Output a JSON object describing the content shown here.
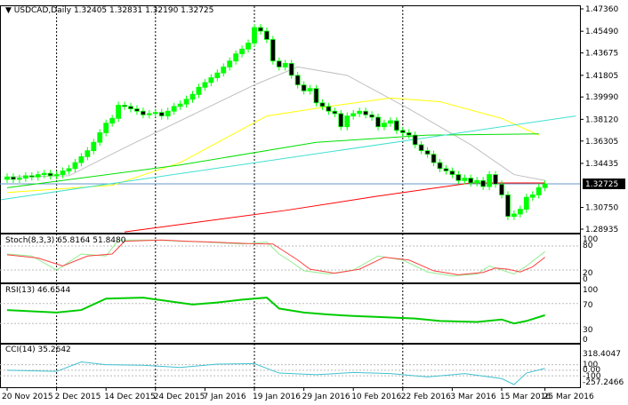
{
  "header": {
    "symbol": "USDCAD",
    "timeframe": "Daily",
    "ohlc": "1.32405 1.32831 1.32190 1.32725"
  },
  "indicators": {
    "stoch": {
      "label": "Stoch(8,3,3) 65.8164 51.8480",
      "levels": [
        "100",
        "80",
        "20",
        "0"
      ]
    },
    "rsi": {
      "label": "RSI(13) 46.6544",
      "levels": [
        "100",
        "70",
        "30",
        "0"
      ]
    },
    "cci": {
      "label": "CCI(14) 35.2642",
      "levels": [
        "318.4047",
        "100",
        "0.00",
        "-100",
        "-257.2466"
      ]
    }
  },
  "colors": {
    "bull": "#00ff00",
    "bear": "#000000",
    "ma_red": "#ff0000",
    "ma_yellow": "#ffff00",
    "ma_green": "#00e000",
    "ma_grey": "#c0c0c0",
    "trend": "#40e0d0",
    "price_line": "#6699cc",
    "stoch_k": "#90ee90",
    "stoch_d": "#ff4040",
    "rsi": "#00cc00",
    "cci": "#40c0d0"
  },
  "chart_data": {
    "type": "candlestick",
    "title": "USDCAD Daily",
    "ylim": [
      1.28935,
      1.4736
    ],
    "y_ticks": [
      "1.47360",
      "1.45490",
      "1.43675",
      "1.41805",
      "1.39990",
      "1.38120",
      "1.36305",
      "1.34435",
      "1.30750",
      "1.28935"
    ],
    "current_price": "1.32725",
    "x_labels": [
      "20 Nov 2015",
      "2 Dec 2015",
      "14 Dec 2015",
      "24 Dec 2015",
      "7 Jan 2016",
      "19 Jan 2016",
      "29 Jan 2016",
      "10 Feb 2016",
      "22 Feb 2016",
      "3 Mar 2016",
      "15 Mar 2016",
      "25 Mar 2016"
    ],
    "x_label_bars": [
      0,
      8,
      16,
      24,
      32,
      40,
      48,
      56,
      64,
      72,
      80,
      87
    ],
    "closes": [
      1.333,
      1.331,
      1.332,
      1.334,
      1.333,
      1.335,
      1.336,
      1.334,
      1.335,
      1.338,
      1.34,
      1.345,
      1.35,
      1.355,
      1.362,
      1.37,
      1.378,
      1.382,
      1.393,
      1.392,
      1.39,
      1.388,
      1.385,
      1.386,
      1.387,
      1.384,
      1.388,
      1.392,
      1.394,
      1.398,
      1.402,
      1.408,
      1.412,
      1.416,
      1.42,
      1.425,
      1.43,
      1.436,
      1.44,
      1.445,
      1.458,
      1.455,
      1.448,
      1.43,
      1.425,
      1.428,
      1.418,
      1.41,
      1.405,
      1.407,
      1.395,
      1.392,
      1.388,
      1.386,
      1.375,
      1.384,
      1.386,
      1.388,
      1.385,
      1.383,
      1.375,
      1.378,
      1.38,
      1.372,
      1.37,
      1.368,
      1.36,
      1.355,
      1.352,
      1.345,
      1.34,
      1.338,
      1.335,
      1.33,
      1.332,
      1.328,
      1.33,
      1.325,
      1.335,
      1.327,
      1.318,
      1.3,
      1.302,
      1.306,
      1.316,
      1.318,
      1.3241,
      1.32725
    ],
    "ma_lines": [
      {
        "name": "ma_grey",
        "points": [
          [
            0,
            1.333
          ],
          [
            10,
            1.334
          ],
          [
            20,
            1.36
          ],
          [
            30,
            1.385
          ],
          [
            40,
            1.41
          ],
          [
            47,
            1.425
          ],
          [
            55,
            1.418
          ],
          [
            65,
            1.39
          ],
          [
            75,
            1.36
          ],
          [
            82,
            1.335
          ],
          [
            87,
            1.33
          ]
        ]
      },
      {
        "name": "ma_yellow",
        "points": [
          [
            0,
            1.32
          ],
          [
            17,
            1.326
          ],
          [
            28,
            1.345
          ],
          [
            42,
            1.384
          ],
          [
            52,
            1.392
          ],
          [
            62,
            1.399
          ],
          [
            70,
            1.396
          ],
          [
            80,
            1.382
          ],
          [
            86,
            1.368
          ]
        ]
      },
      {
        "name": "ma_green",
        "points": [
          [
            0,
            1.324
          ],
          [
            28,
            1.343
          ],
          [
            50,
            1.362
          ],
          [
            68,
            1.368
          ],
          [
            86,
            1.369
          ]
        ]
      },
      {
        "name": "ma_red",
        "points": [
          [
            19,
            1.287
          ],
          [
            45,
            1.305
          ],
          [
            60,
            1.317
          ],
          [
            75,
            1.328
          ],
          [
            87,
            1.328
          ]
        ]
      },
      {
        "name": "trend",
        "points": [
          [
            -1,
            1.314
          ],
          [
            92,
            1.384
          ]
        ]
      }
    ],
    "stoch_k": [
      [
        0,
        60
      ],
      [
        4,
        55
      ],
      [
        8,
        20
      ],
      [
        12,
        60
      ],
      [
        16,
        55
      ],
      [
        18,
        95
      ],
      [
        24,
        95
      ],
      [
        28,
        92
      ],
      [
        32,
        90
      ],
      [
        38,
        85
      ],
      [
        42,
        90
      ],
      [
        44,
        60
      ],
      [
        46,
        40
      ],
      [
        48,
        18
      ],
      [
        52,
        10
      ],
      [
        56,
        20
      ],
      [
        60,
        55
      ],
      [
        64,
        45
      ],
      [
        68,
        15
      ],
      [
        72,
        5
      ],
      [
        76,
        10
      ],
      [
        78,
        30
      ],
      [
        80,
        20
      ],
      [
        82,
        10
      ],
      [
        84,
        30
      ],
      [
        87,
        66
      ]
    ],
    "stoch_d": [
      [
        0,
        58
      ],
      [
        5,
        50
      ],
      [
        9,
        30
      ],
      [
        13,
        55
      ],
      [
        17,
        60
      ],
      [
        19,
        92
      ],
      [
        25,
        95
      ],
      [
        29,
        92
      ],
      [
        33,
        90
      ],
      [
        39,
        86
      ],
      [
        43,
        85
      ],
      [
        45,
        65
      ],
      [
        47,
        45
      ],
      [
        49,
        22
      ],
      [
        53,
        12
      ],
      [
        57,
        22
      ],
      [
        61,
        52
      ],
      [
        65,
        45
      ],
      [
        69,
        18
      ],
      [
        73,
        8
      ],
      [
        77,
        14
      ],
      [
        79,
        25
      ],
      [
        81,
        22
      ],
      [
        83,
        15
      ],
      [
        85,
        28
      ],
      [
        87,
        52
      ]
    ],
    "rsi": [
      [
        0,
        57
      ],
      [
        8,
        52
      ],
      [
        12,
        57
      ],
      [
        16,
        80
      ],
      [
        22,
        82
      ],
      [
        26,
        75
      ],
      [
        30,
        68
      ],
      [
        34,
        72
      ],
      [
        38,
        78
      ],
      [
        42,
        82
      ],
      [
        44,
        60
      ],
      [
        48,
        52
      ],
      [
        52,
        48
      ],
      [
        56,
        45
      ],
      [
        60,
        43
      ],
      [
        66,
        40
      ],
      [
        70,
        35
      ],
      [
        76,
        33
      ],
      [
        80,
        38
      ],
      [
        82,
        30
      ],
      [
        84,
        35
      ],
      [
        87,
        46.65
      ]
    ],
    "cci": [
      [
        0,
        0
      ],
      [
        8,
        -20
      ],
      [
        12,
        150
      ],
      [
        16,
        100
      ],
      [
        22,
        90
      ],
      [
        28,
        50
      ],
      [
        34,
        110
      ],
      [
        40,
        120
      ],
      [
        44,
        -50
      ],
      [
        50,
        -80
      ],
      [
        56,
        -40
      ],
      [
        62,
        -60
      ],
      [
        68,
        -120
      ],
      [
        74,
        -60
      ],
      [
        80,
        -150
      ],
      [
        82,
        -257
      ],
      [
        84,
        -50
      ],
      [
        87,
        35
      ]
    ]
  }
}
